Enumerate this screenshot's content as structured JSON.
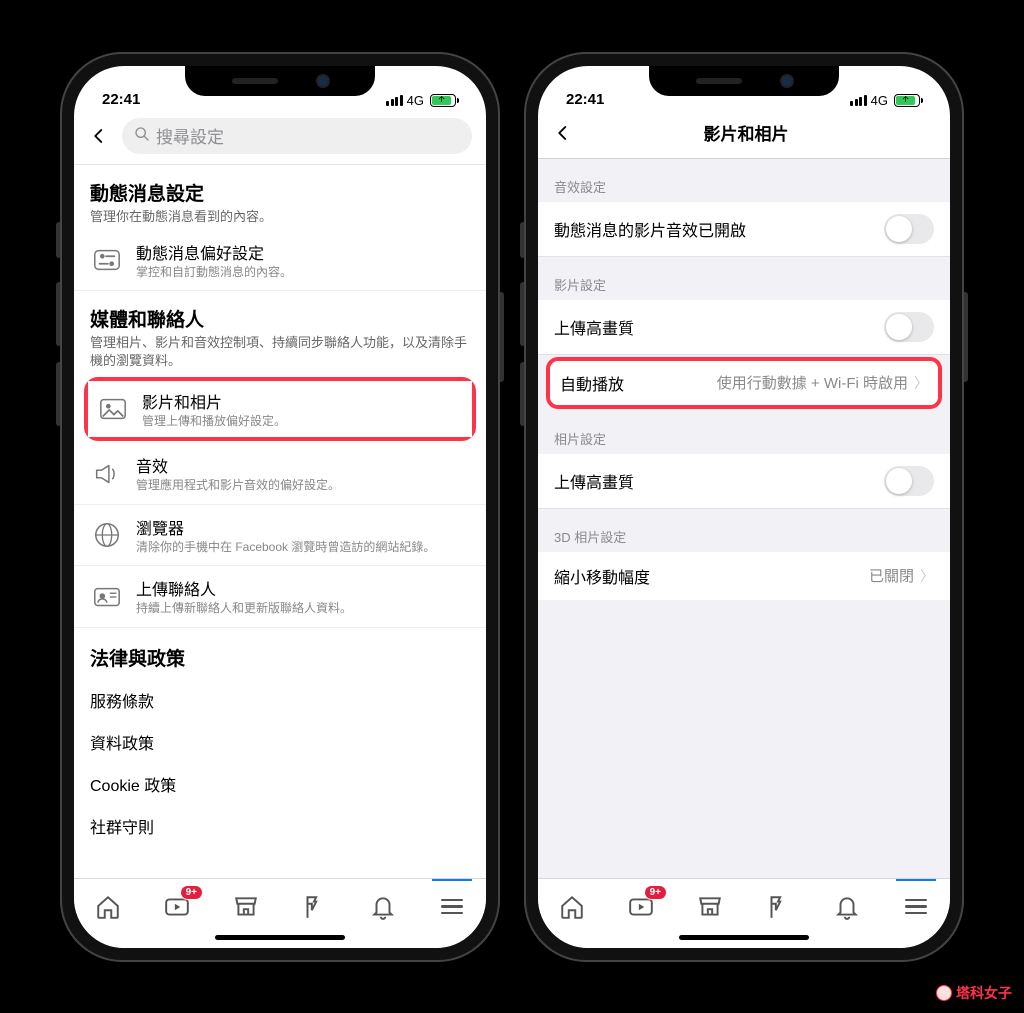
{
  "status": {
    "time": "22:41",
    "network": "4G"
  },
  "left": {
    "search_placeholder": "搜尋設定",
    "sections": {
      "feed": {
        "title": "動態消息設定",
        "subtitle": "管理你在動態消息看到的內容。",
        "pref": {
          "title": "動態消息偏好設定",
          "subtitle": "掌控和自訂動態消息的內容。"
        }
      },
      "media": {
        "title": "媒體和聯絡人",
        "subtitle": "管理相片、影片和音效控制項、持續同步聯絡人功能，以及清除手機的瀏覽資料。",
        "items": {
          "videos_photos": {
            "title": "影片和相片",
            "subtitle": "管理上傳和播放偏好設定。"
          },
          "sounds": {
            "title": "音效",
            "subtitle": "管理應用程式和影片音效的偏好設定。"
          },
          "browser": {
            "title": "瀏覽器",
            "subtitle": "清除你的手機中在 Facebook 瀏覽時曾造訪的網站紀錄。"
          },
          "contacts": {
            "title": "上傳聯絡人",
            "subtitle": "持續上傳新聯絡人和更新版聯絡人資料。"
          }
        }
      },
      "legal": {
        "title": "法律與政策",
        "links": {
          "terms": "服務條款",
          "data": "資料政策",
          "cookie": "Cookie 政策",
          "community": "社群守則"
        }
      }
    }
  },
  "right": {
    "title": "影片和相片",
    "groups": {
      "sound": {
        "header": "音效設定",
        "feed_sound_on": "動態消息的影片音效已開啟"
      },
      "video": {
        "header": "影片設定",
        "upload_hd": "上傳高畫質",
        "autoplay_label": "自動播放",
        "autoplay_value": "使用行動數據 + Wi-Fi 時啟用"
      },
      "photo": {
        "header": "相片設定",
        "upload_hd": "上傳高畫質"
      },
      "three_d": {
        "header": "3D 相片設定",
        "reduce_label": "縮小移動幅度",
        "reduce_value": "已關閉"
      }
    }
  },
  "tabs": {
    "badge": "9+"
  },
  "watermark": "塔科女子"
}
